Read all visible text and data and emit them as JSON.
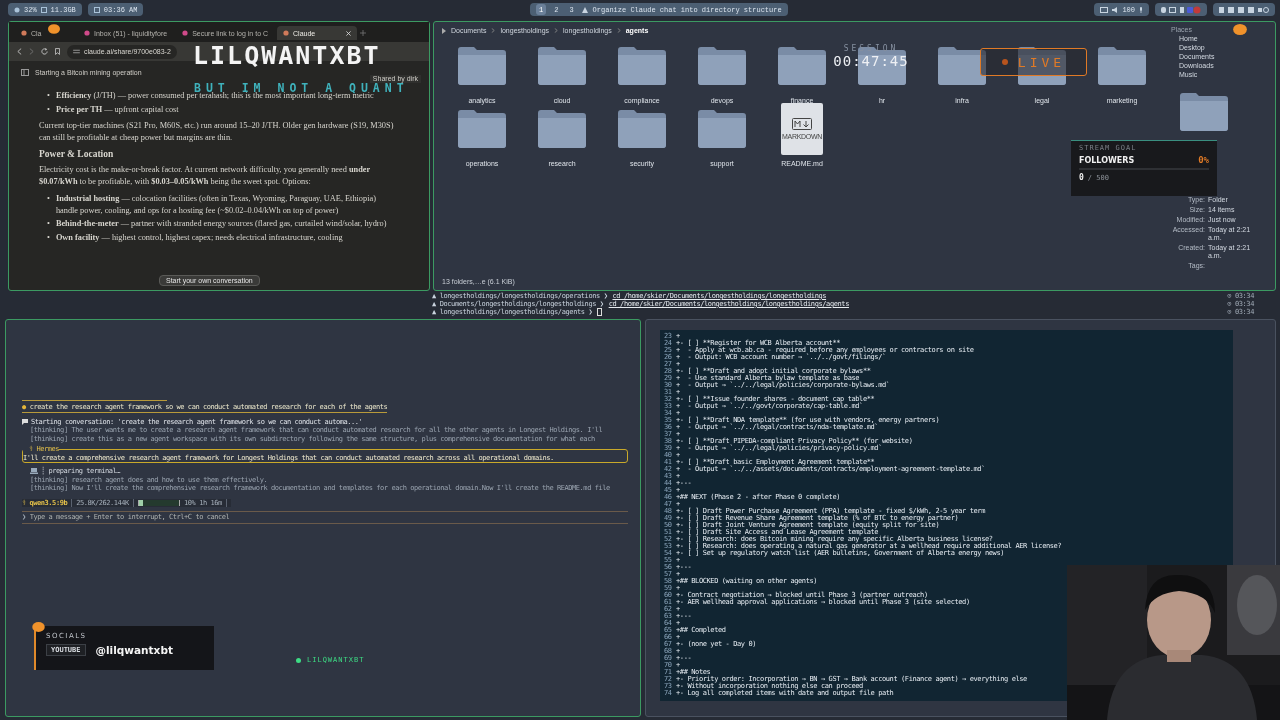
{
  "top_bar": {
    "cpu": "32%",
    "memory": "11.3GB",
    "clock": "03:36 AM",
    "workspaces": [
      {
        "label": "1",
        "selected": true
      },
      {
        "label": "2",
        "selected": false
      },
      {
        "label": "3",
        "selected": false
      }
    ],
    "window_title": "Organize Claude chat into directory structure",
    "volume": "100"
  },
  "browser": {
    "tabs": [
      {
        "title": "Cla",
        "selected": false,
        "closable": false
      },
      {
        "title": "Inbox (51) - liquidityfore",
        "selected": false,
        "closable": false
      },
      {
        "title": "Secure link to log in to C",
        "selected": false,
        "closable": false
      },
      {
        "title": "Claude",
        "selected": true,
        "closable": true
      }
    ],
    "url": "claude.ai/share/9700e083-2",
    "conversation_title": "Starting a Bitcoin mining operation",
    "shared_by": "Shared by dirk",
    "content": [
      {
        "kind": "bullets",
        "marker": "•",
        "items": [
          "**Efficiency** (J/TH) — power consumed per terahash; this is the most important long-term metric",
          "**Price per TH** — upfront capital cost"
        ]
      },
      {
        "kind": "paragraph",
        "text": "Current top-tier machines (S21 Pro, M60S, etc.) run around 15–20 J/TH. Older gen hardware (S19, M30S) can still be profitable at cheap power but margins are thin."
      },
      {
        "kind": "heading",
        "text": "Power & Location"
      },
      {
        "kind": "paragraph",
        "text": "Electricity cost is the make-or-break factor. At current network difficulty, you generally need **under $0.07/kWh** to be profitable, with **$0.03–0.05/kWh** being the sweet spot. Options:"
      },
      {
        "kind": "bullets",
        "marker": "•",
        "items": [
          "**Industrial hosting** — colocation facilities (often in Texas, Wyoming, Paraguay, UAE, Ethiopia) handle power, cooling, and ops for a hosting fee (~$0.02–0.04/kWh on top of power)",
          "**Behind-the-meter** — partner with stranded energy sources (flared gas, curtailed wind/solar, hydro)",
          "**Own facility** — highest control, highest capex; needs electrical infrastructure, cooling"
        ]
      }
    ],
    "cta": "Start your own conversation"
  },
  "file_manager": {
    "breadcrumb": [
      {
        "label": "Documents",
        "current": false
      },
      {
        "label": "longestholdings",
        "current": false
      },
      {
        "label": "longestholdings",
        "current": false
      },
      {
        "label": "agents",
        "current": true
      }
    ],
    "items": [
      {
        "name": "analytics",
        "kind": "folder"
      },
      {
        "name": "cloud",
        "kind": "folder"
      },
      {
        "name": "compliance",
        "kind": "folder"
      },
      {
        "name": "devops",
        "kind": "folder"
      },
      {
        "name": "finance",
        "kind": "folder"
      },
      {
        "name": "hr",
        "kind": "folder"
      },
      {
        "name": "infra",
        "kind": "folder"
      },
      {
        "name": "legal",
        "kind": "folder"
      },
      {
        "name": "marketing",
        "kind": "folder"
      },
      {
        "name": "operations",
        "kind": "folder"
      },
      {
        "name": "research",
        "kind": "folder"
      },
      {
        "name": "security",
        "kind": "folder"
      },
      {
        "name": "support",
        "kind": "folder"
      },
      {
        "name": "README.md",
        "kind": "markdown",
        "badge": "MARKDOWN"
      }
    ],
    "status": "13 folders,…e (6.1 KiB)",
    "places_title": "Places",
    "places": [
      "Home",
      "Desktop",
      "Documents",
      "Downloads",
      "Music"
    ],
    "details": [
      {
        "label": "Type:",
        "value": "Folder"
      },
      {
        "label": "Size:",
        "value": "14 items"
      },
      {
        "label": "Modified:",
        "value": "Just now"
      },
      {
        "label": "Accessed:",
        "value": "Today at 2:21 a.m."
      },
      {
        "label": "Created:",
        "value": "Today at 2:21 a.m."
      },
      {
        "label": "Tags:"
      }
    ]
  },
  "shell": {
    "lines": [
      {
        "prompt": "▲ longestholdings/longestholdings/operations ❯",
        "command": "cd /home/skier/Documents/longestholdings/longestholdings",
        "time": "⊙ 03:34",
        "cursor": false
      },
      {
        "prompt": "▲ Documents/longestholdings/longestholdings ❯",
        "command": "cd /home/skier/Documents/longestholdings/longestholdings/agents",
        "time": "⊙ 03:34",
        "cursor": false
      },
      {
        "prompt": "▲ longestholdings/longestholdings/agents ❯",
        "time": "⊙ 03:34",
        "cursor": true
      }
    ]
  },
  "agent_terminal": {
    "prompt_marker": "●",
    "prompt": "create the research agent framework so we can conduct automated research for each of the agents",
    "log": [
      {
        "kind": "event",
        "text": "Starting conversation: 'create the research agent framework so we can conduct automa...'"
      },
      {
        "kind": "thinking",
        "text": "[thinking] The user wants me to create a research agent framework that can conduct automated research for all the other agents in Longest Holdings. I'll"
      },
      {
        "kind": "thinking",
        "text": "[thinking] create this as a new agent workspace with its own subdirectory following the same structure, plus comprehensive documentation for what each"
      }
    ],
    "reply": {
      "title": "⚕ Hermes",
      "text": "I'll create a comprehensive research agent framework for Longest Holdings that can conduct automated research across all operational domains."
    },
    "log2": [
      {
        "kind": "tool",
        "text": "┊ preparing terminal…"
      },
      {
        "kind": "thinking",
        "text": "[thinking] research agent does and how to use them effectively."
      },
      {
        "kind": "thinking",
        "text": "[thinking] Now I'll create the comprehensive research framework documentation and templates for each operational domain.Now I'll create the README.md file"
      }
    ],
    "status": {
      "model": "⚕ qwen3.5:9b",
      "tokens": "25.8K/262.144K",
      "level": 0.1,
      "percent": "10%",
      "elapsed": "1h 16m"
    },
    "input_prompt": "❯",
    "placeholder": "Type a message + Enter to interrupt, Ctrl+C to cancel"
  },
  "editor": {
    "lines": [
      {
        "number": "23",
        "text": "+"
      },
      {
        "number": "24",
        "text": "+- [ ] **Register for WCB Alberta account**"
      },
      {
        "number": "25",
        "text": "+  - Apply at wcb.ab.ca - required before any employees or contractors on site"
      },
      {
        "number": "26",
        "text": "+  - Output: WCB account number → `../../govt/filings/`"
      },
      {
        "number": "27",
        "text": "+"
      },
      {
        "number": "28",
        "text": "+- [ ] **Draft and adopt initial corporate bylaws**"
      },
      {
        "number": "29",
        "text": "+  - Use standard Alberta bylaw template as base"
      },
      {
        "number": "30",
        "text": "+  - Output → `../../legal/policies/corporate-bylaws.md`"
      },
      {
        "number": "31",
        "text": "+"
      },
      {
        "number": "32",
        "text": "+- [ ] **Issue founder shares - document cap table**"
      },
      {
        "number": "33",
        "text": "+  - Output → `../../govt/corporate/cap-table.md`"
      },
      {
        "number": "34",
        "text": "+"
      },
      {
        "number": "35",
        "text": "+- [ ] **Draft NDA template** (for use with vendors, energy partners)"
      },
      {
        "number": "36",
        "text": "+  - Output → `../../legal/contracts/nda-template.md`"
      },
      {
        "number": "37",
        "text": "+"
      },
      {
        "number": "38",
        "text": "+- [ ] **Draft PIPEDA-compliant Privacy Policy** (for website)"
      },
      {
        "number": "39",
        "text": "+  - Output → `../../legal/policies/privacy-policy.md`"
      },
      {
        "number": "40",
        "text": "+"
      },
      {
        "number": "41",
        "text": "+- [ ] **Draft basic Employment Agreement template**"
      },
      {
        "number": "42",
        "text": "+  - Output → `../../assets/documents/contracts/employment-agreement-template.md`"
      },
      {
        "number": "43",
        "text": "+"
      },
      {
        "number": "44",
        "text": "+---"
      },
      {
        "number": "45",
        "text": "+"
      },
      {
        "number": "46",
        "text": "+## NEXT (Phase 2 - after Phase 0 complete)"
      },
      {
        "number": "47",
        "text": "+"
      },
      {
        "number": "48",
        "text": "+- [ ] Draft Power Purchase Agreement (PPA) template - fixed $/kWh, 2-5 year term"
      },
      {
        "number": "49",
        "text": "+- [ ] Draft Revenue Share Agreement template (% of BTC to energy partner)"
      },
      {
        "number": "50",
        "text": "+- [ ] Draft Joint Venture Agreement template (equity split for site)"
      },
      {
        "number": "51",
        "text": "+- [ ] Draft Site Access and Lease Agreement template"
      },
      {
        "number": "52",
        "text": "+- [ ] Research: does Bitcoin mining require any specific Alberta business license?"
      },
      {
        "number": "53",
        "text": "+- [ ] Research: does operating a natural gas generator at a wellhead require additional AER license?"
      },
      {
        "number": "54",
        "text": "+- [ ] Set up regulatory watch list (AER bulletins, Government of Alberta energy news)"
      },
      {
        "number": "55",
        "text": "+"
      },
      {
        "number": "56",
        "text": "+---"
      },
      {
        "number": "57",
        "text": "+"
      },
      {
        "number": "58",
        "text": "+## BLOCKED (waiting on other agents)"
      },
      {
        "number": "59",
        "text": "+"
      },
      {
        "number": "60",
        "text": "+- Contract negotiation → blocked until Phase 3 (partner outreach)"
      },
      {
        "number": "61",
        "text": "+- AER wellhead approval applications → blocked until Phase 3 (site selected)"
      },
      {
        "number": "62",
        "text": "+"
      },
      {
        "number": "63",
        "text": "+---"
      },
      {
        "number": "64",
        "text": "+"
      },
      {
        "number": "65",
        "text": "+## Completed"
      },
      {
        "number": "66",
        "text": "+"
      },
      {
        "number": "67",
        "text": "+- (none yet - Day 0)"
      },
      {
        "number": "68",
        "text": "+"
      },
      {
        "number": "69",
        "text": "+---"
      },
      {
        "number": "70",
        "text": "+"
      },
      {
        "number": "71",
        "text": "+## Notes"
      },
      {
        "number": "72",
        "text": "+- Priority order: Incorporation → BN → GST → Bank account (Finance agent) → everything else"
      },
      {
        "number": "73",
        "text": "+- Without incorporation nothing else can proceed"
      },
      {
        "number": "74",
        "text": "+- Log all completed items with date and output file path"
      }
    ]
  },
  "overlay": {
    "logo": "LILQWANTXBT",
    "tagline": "BUT IM NOT A QUANT",
    "session_label": "SESSION",
    "session_time": "00:47:45",
    "live": "LIVE",
    "stream_goal": {
      "label": "STREAM GOAL",
      "title": "FOLLOWERS",
      "percent": "0%",
      "level": 0,
      "count": "0",
      "target": "/ 500"
    },
    "socials": {
      "label": "SOCIALS",
      "platform": "YOUTUBE",
      "handle": "@lilqwantxbt"
    },
    "channel_tag": "LILQWANTXBT"
  }
}
